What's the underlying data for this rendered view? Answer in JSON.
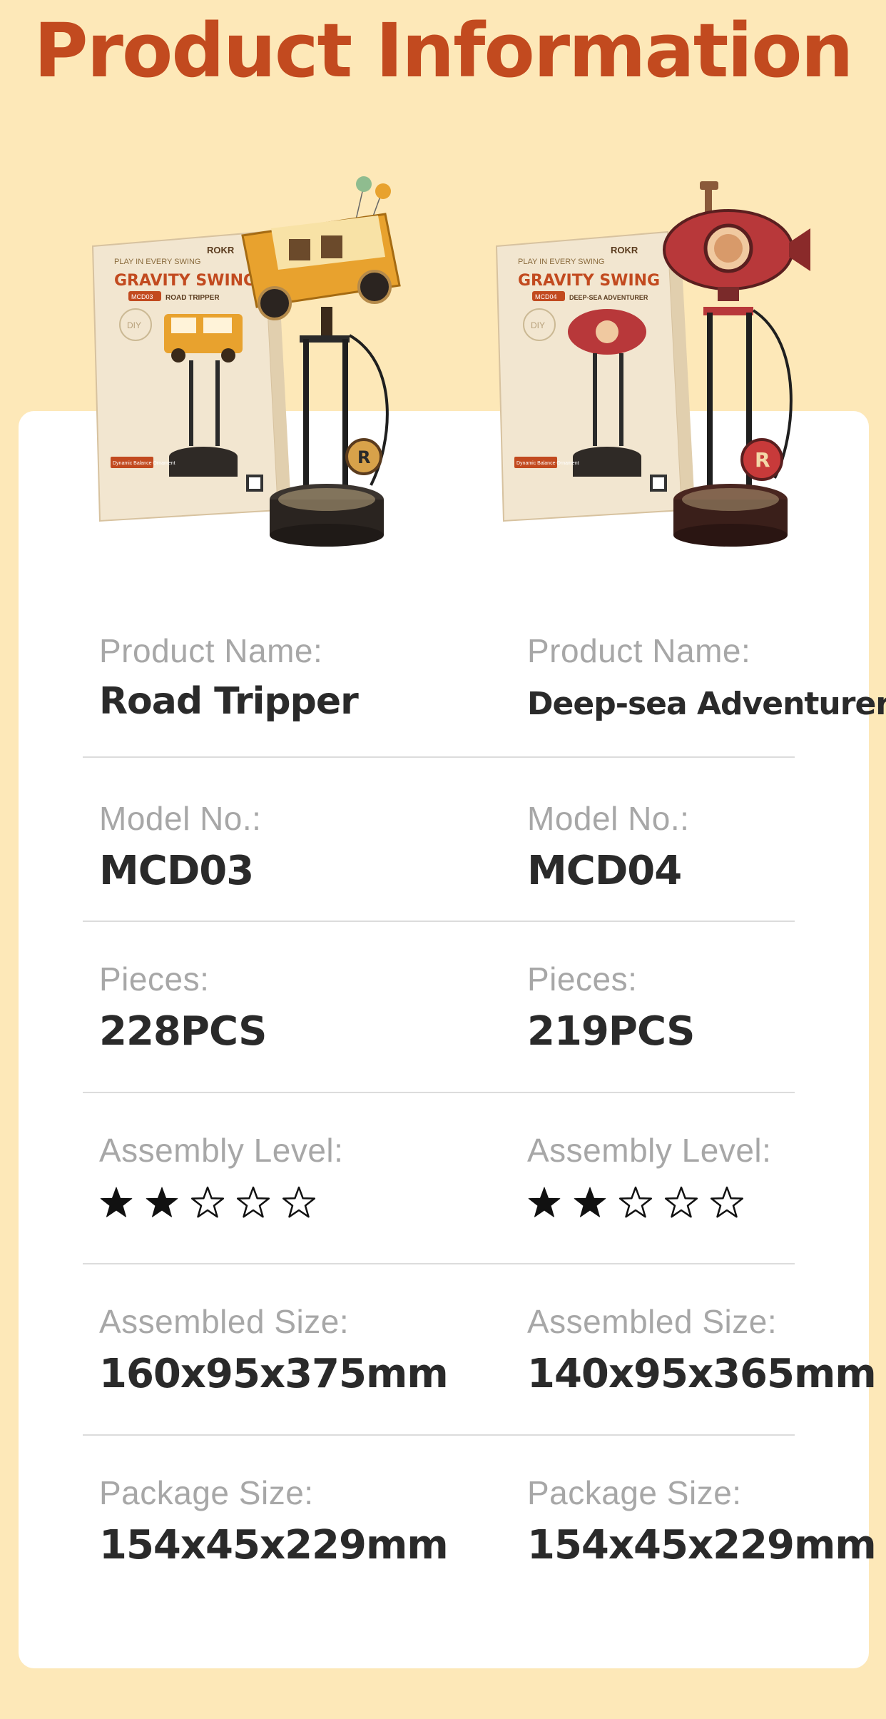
{
  "title": "Product Information",
  "columns": [
    {
      "name_label": "Product Name:",
      "name": "Road Tripper",
      "model_label": "Model No.:",
      "model": "MCD03",
      "pieces_label": "Pieces:",
      "pieces": "228PCS",
      "level_label": "Assembly Level:",
      "level": 2,
      "level_max": 5,
      "assembled_label": "Assembled Size:",
      "assembled": "160x95x375mm",
      "package_label": "Package Size:",
      "package": "154x45x229mm",
      "box": {
        "brand": "ROKR",
        "headline": "GRAVITY SWING",
        "sub": "PLAY IN EVERY SWING",
        "code": "MCD03",
        "line": "ROAD TRIPPER",
        "tagline": "Dynamic Balance Ornament",
        "diy": "DIY"
      },
      "accent": "#e8a22e"
    },
    {
      "name_label": "Product Name:",
      "name": "Deep-sea Adventurer",
      "model_label": "Model No.:",
      "model": "MCD04",
      "pieces_label": "Pieces:",
      "pieces": "219PCS",
      "level_label": "Assembly Level:",
      "level": 2,
      "level_max": 5,
      "assembled_label": "Assembled Size:",
      "assembled": "140x95x365mm",
      "package_label": "Package Size:",
      "package": "154x45x229mm",
      "box": {
        "brand": "ROKR",
        "headline": "GRAVITY SWING",
        "sub": "PLAY IN EVERY SWING",
        "code": "MCD04",
        "line": "DEEP-SEA ADVENTURER",
        "tagline": "Dynamic Balance Ornament",
        "diy": "DIY"
      },
      "accent": "#c83a3a"
    }
  ],
  "colors": {
    "background": "#fde8b8",
    "title": "#c24a1f",
    "card": "#ffffff"
  },
  "icons": [
    "star-filled-icon",
    "star-outline-icon"
  ]
}
